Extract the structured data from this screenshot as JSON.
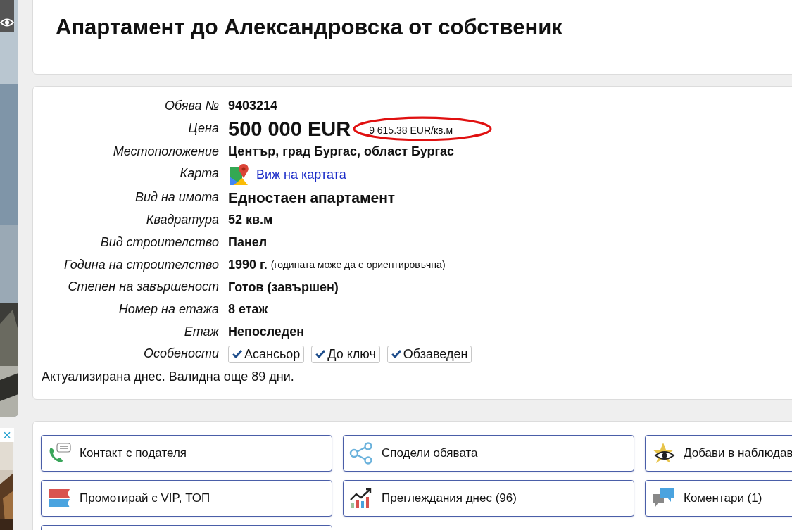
{
  "title": "Апартамент до Александровска от собственик",
  "details": [
    {
      "label": "Обява №",
      "kind": "text",
      "value": "9403214"
    },
    {
      "label": "Цена",
      "kind": "price",
      "value": "500 000 EUR",
      "per_sqm": "9 615.38 EUR/кв.м",
      "highlighted": true
    },
    {
      "label": "Местоположение",
      "kind": "text",
      "value": "Център, град Бургас, област Бургас"
    },
    {
      "label": "Карта",
      "kind": "map",
      "value": "Виж на картата"
    },
    {
      "label": "Вид на имота",
      "kind": "large",
      "value": "Едностаен апартамент"
    },
    {
      "label": "Квадратура",
      "kind": "text",
      "value": "52 кв.м"
    },
    {
      "label": "Вид строителство",
      "kind": "text",
      "value": "Панел"
    },
    {
      "label": "Година на строителство",
      "kind": "year",
      "value": "1990 г.",
      "note": "(годината може да е ориентировъчна)"
    },
    {
      "label": "Степен на завършеност",
      "kind": "text",
      "value": "Готов (завършен)"
    },
    {
      "label": "Номер на етажа",
      "kind": "text",
      "value": "8 етаж"
    },
    {
      "label": "Етаж",
      "kind": "text",
      "value": "Непоследен"
    },
    {
      "label": "Особености",
      "kind": "features",
      "features": [
        {
          "label": "Асансьор",
          "checked": true
        },
        {
          "label": "До ключ",
          "checked": true
        },
        {
          "label": "Обзаведен",
          "checked": true
        }
      ]
    }
  ],
  "validity": "Актуализирана днес. Валидна още 89 дни.",
  "actions": [
    {
      "kind": "contact",
      "label": "Контакт с подателя"
    },
    {
      "kind": "share",
      "label": "Сподели обявата"
    },
    {
      "kind": "watch",
      "label": "Добави в наблюдав"
    },
    {
      "kind": "promote",
      "label": "Промотирай с VIP, ТОП"
    },
    {
      "kind": "views",
      "label": "Преглеждания днес (96)"
    },
    {
      "kind": "comments",
      "label": "Коментари (1)"
    }
  ],
  "ad_close": "×"
}
